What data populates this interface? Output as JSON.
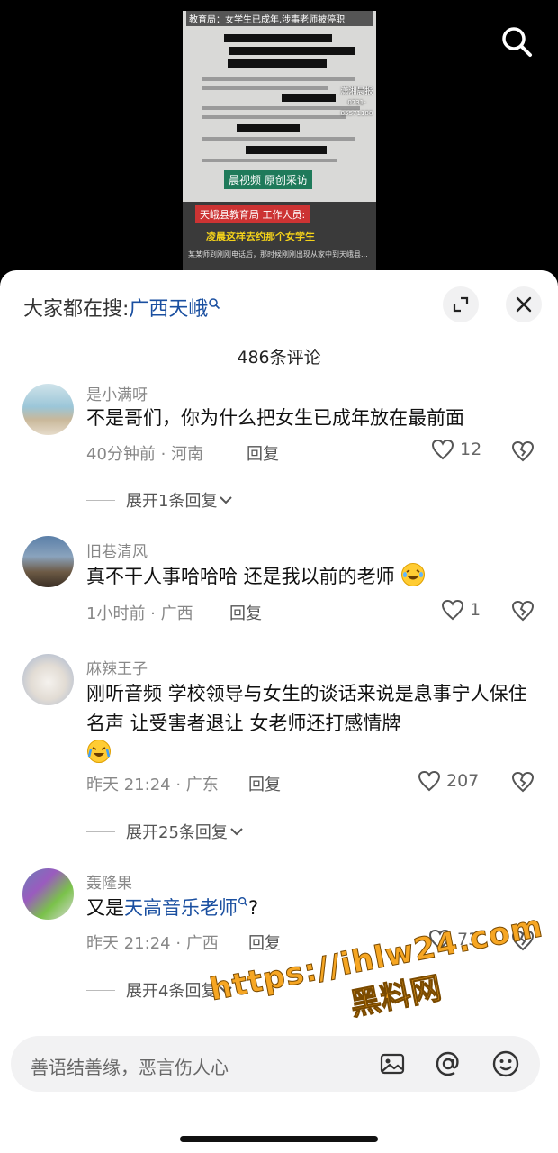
{
  "video": {
    "frame_title": "教育局：女学生已成年,涉事老师被停职",
    "stamp_line1": "潇湘晨报",
    "stamp_line2": "0731-85571188",
    "tag": "晨视频 原创采访",
    "speaker": "天峨县教育局 工作人员:",
    "caption": "凌晨这样去约那个女学生",
    "subtitle": "某某师到刚刚电话后，那时候刚刚出现从家中到天峨县..."
  },
  "sheet": {
    "trending_prefix": "大家都在搜:",
    "trending_term": "广西天峨",
    "comment_count": "486条评论",
    "reply_label": "回复"
  },
  "comments": [
    {
      "user": "是小满呀",
      "text": "不是哥们，你为什么把女生已成年放在最前面",
      "time": "40分钟前 · 河南",
      "likes": "12",
      "expand": "展开1条回复"
    },
    {
      "user": "旧巷清风",
      "text": "真不干人事哈哈哈  还是我以前的老师",
      "time": "1小时前 · 广西",
      "likes": "1"
    },
    {
      "user": "麻辣王子",
      "text": "刚听音频  学校领导与女生的谈话来说是息事宁人保住名声 让受害者退让 女老师还打感情牌",
      "time": "昨天 21:24 · 广东",
      "likes": "207",
      "expand": "展开25条回复"
    },
    {
      "user": "轰隆果",
      "text_prefix": "又是",
      "text_link": "天高音乐老师",
      "text_suffix": "?",
      "time": "昨天 21:24 · 广西",
      "likes": "73",
      "expand": "展开4条回复"
    }
  ],
  "input": {
    "placeholder": "善语结善缘，恶言伤人心"
  },
  "watermark": {
    "url": "https://ihlw24.com",
    "name": "黑料网"
  },
  "icons": [
    "search-icon",
    "minimize-icon",
    "close-icon",
    "heart-icon",
    "broken-heart-icon",
    "chevron-down-icon",
    "image-icon",
    "at-icon",
    "emoji-icon"
  ]
}
